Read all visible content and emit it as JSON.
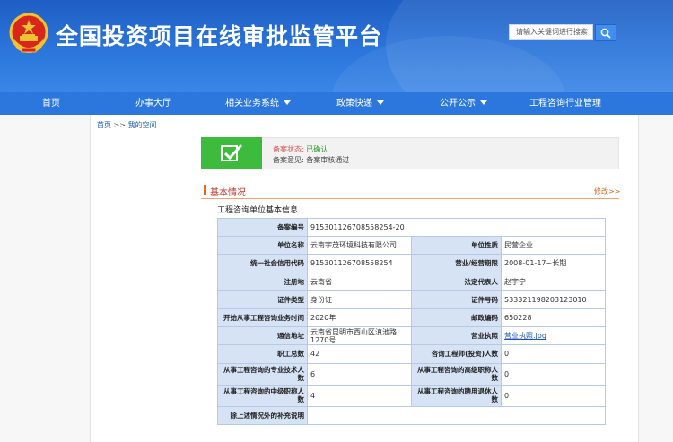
{
  "header": {
    "title": "全国投资项目在线审批监管平台",
    "search_placeholder": "请输入关键词进行搜索"
  },
  "nav": {
    "items": [
      {
        "label": "首页"
      },
      {
        "label": "办事大厅"
      },
      {
        "label": "相关业务系统"
      },
      {
        "label": "政策快递"
      },
      {
        "label": "公开公示"
      },
      {
        "label": "工程咨询行业管理"
      }
    ]
  },
  "breadcrumb": {
    "home": "首页",
    "sep": ">>",
    "current": "我的空间"
  },
  "status": {
    "state_label": "备案状态:",
    "state_value": "已确认",
    "opinion_label": "备案意见:",
    "opinion_value": "备案审核通过"
  },
  "section": {
    "title": "基本情况",
    "edit_link": "修改>>",
    "subtitle": "工程咨询单位基本信息"
  },
  "table": {
    "rows": [
      {
        "k1": "备案编号",
        "v1": "915301126708558254-20",
        "span": true
      },
      {
        "k1": "单位名称",
        "v1": "云南宇茂环境科技有限公司",
        "k2": "单位性质",
        "v2": "民营企业"
      },
      {
        "k1": "统一社会信用代码",
        "v1": "915301126708558254",
        "k2": "营业/经营期限",
        "v2": "2008-01-17~长期"
      },
      {
        "k1": "注册地",
        "v1": "云南省",
        "k2": "法定代表人",
        "v2": "赵宇宁"
      },
      {
        "k1": "证件类型",
        "v1": "身份证",
        "k2": "证件号码",
        "v2": "533321198203123010"
      },
      {
        "k1": "开始从事工程咨询业务时间",
        "v1": "2020年",
        "k2": "邮政编码",
        "v2": "650228"
      },
      {
        "k1": "通信地址",
        "v1": "云南省昆明市西山区滇池路1270号",
        "k2": "营业执照",
        "v2": "营业执照.jpg",
        "link": true
      },
      {
        "k1": "职工总数",
        "v1": "42",
        "k2": "咨询工程师(投资)人数",
        "v2": "0"
      },
      {
        "k1": "从事工程咨询的专业技术人数",
        "v1": "6",
        "k2": "从事工程咨询的高级职称人数",
        "v2": "0"
      },
      {
        "k1": "从事工程咨询的中级职称人数",
        "v1": "4",
        "k2": "从事工程咨询的聘用退休人数",
        "v2": "0"
      },
      {
        "k1": "除上述情况外的补充说明",
        "v1": "",
        "span": true
      }
    ]
  }
}
